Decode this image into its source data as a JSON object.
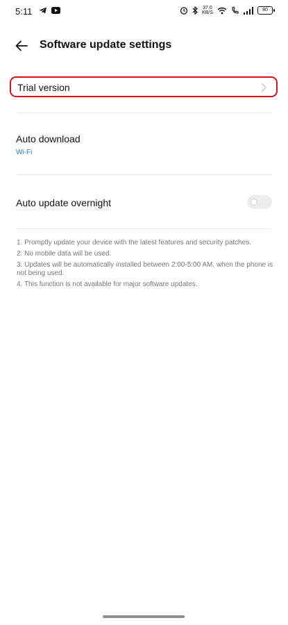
{
  "status_bar": {
    "time": "5:11",
    "left_icons": [
      "telegram-icon",
      "youtube-icon"
    ],
    "right_icons": [
      "alarm-icon",
      "bluetooth-icon",
      "wifi-icon",
      "wifi-call-icon",
      "signal-icon"
    ],
    "speed_value": "37.0",
    "speed_unit": "KB/S",
    "battery": "80"
  },
  "header": {
    "title": "Software update settings"
  },
  "rows": {
    "trial_version": "Trial version",
    "auto_download": {
      "label": "Auto download",
      "value": "Wi-Fi"
    },
    "auto_update_overnight": {
      "label": "Auto update overnight",
      "toggle_on": false
    }
  },
  "notes": [
    "1. Promptly update your device with the latest features and security patches.",
    "2. No mobile data will be used.",
    "3. Updates will be automatically installed between 2:00-5:00 AM, when the phone is not being used.",
    "4. This function is not available for major software updates."
  ],
  "colors": {
    "highlight_border": "#e0101a",
    "link_blue": "#2b7bdc"
  }
}
